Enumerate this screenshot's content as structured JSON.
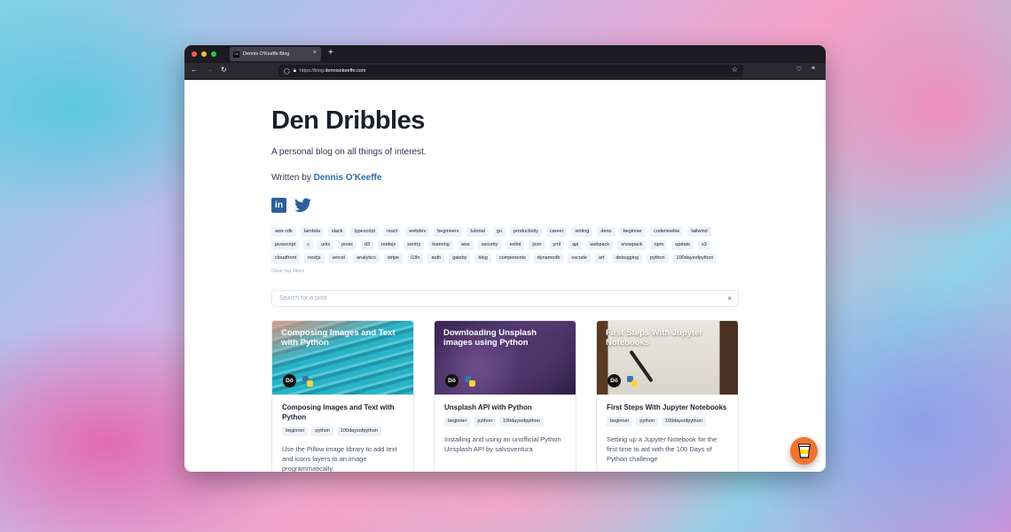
{
  "browser": {
    "tab_title": "Dennis O'Keeffe Blog",
    "tab_favicon": "Dö",
    "url_prefix": "https://blog.",
    "url_host": "dennisokeeffe.com",
    "new_tab": "+",
    "close": "×"
  },
  "page": {
    "title": "Den Dribbles",
    "tagline": "A personal blog on all things of interest.",
    "written_by": "Written by ",
    "author": "Dennis O'Keeffe",
    "clear_filters": "Clear tag filters",
    "search_placeholder": "Search for a post",
    "search_clear": "×"
  },
  "tags": [
    "aws cdk",
    "lambda",
    "slack",
    "typescript",
    "react",
    "webdev",
    "beginners",
    "tutorial",
    "go",
    "productivity",
    "career",
    "writing",
    "deno",
    "beginner",
    "codenewbie",
    "tailwind",
    "javascript",
    "c",
    "unix",
    "posix",
    "d3",
    "nodejs",
    "sentry",
    "learning",
    "aws",
    "security",
    "eslint",
    "json",
    "yml",
    "api",
    "webpack",
    "snowpack",
    "npm",
    "update",
    "s3",
    "cloudfront",
    "nextjs",
    "vercel",
    "analytics",
    "stripe",
    "i18n",
    "auth",
    "gatsby",
    "blog",
    "components",
    "dynamodb",
    "vscode",
    "art",
    "debugging",
    "python",
    "100daysofpython"
  ],
  "cards": [
    {
      "image_title": "Composing Images and Text with Python",
      "title": "Composing Images and Text with Python",
      "tags": [
        "beginner",
        "python",
        "100daysofpython"
      ],
      "description": "Use the Pillow image library to add text and icons layers to an image programmatically."
    },
    {
      "image_title": "Downloading Unsplash images  using Python",
      "title": "Unsplash API with Python",
      "tags": [
        "beginner",
        "python",
        "100daysofpython"
      ],
      "description": "Installing and using an unofficial Python Unsplash API by salvoventura"
    },
    {
      "image_title": "First Steps With Jupyter Notebooks",
      "title": "First Steps With Jupyter Notebooks",
      "tags": [
        "beginner",
        "python",
        "100daysofpython"
      ],
      "description": "Setting up a Jupyter Notebook for the first time to aid with the 100 Days of Python challenge"
    }
  ],
  "logo_text": "Dö",
  "colors": {
    "link": "#2b6cb0",
    "coffee_button": "#f3742e",
    "linkedin": "#2d5f9a",
    "twitter": "#2d5f9a"
  }
}
